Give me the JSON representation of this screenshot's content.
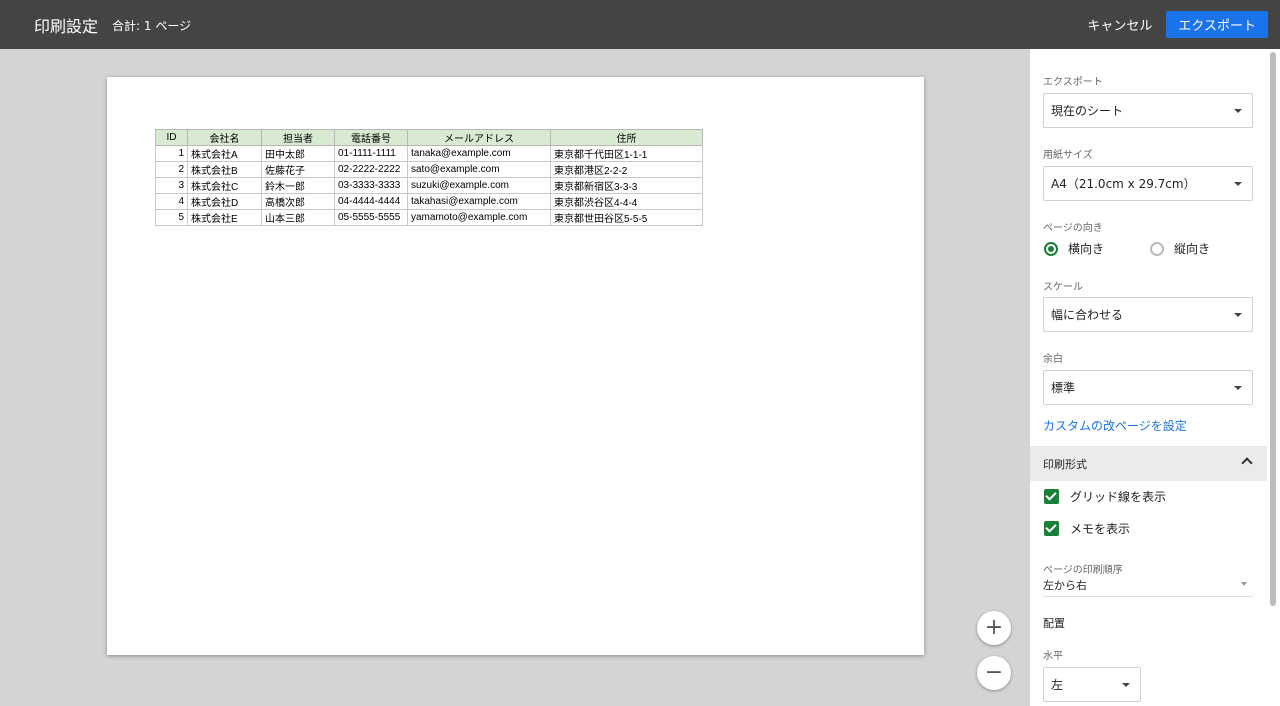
{
  "header": {
    "title": "印刷設定",
    "subtitle": "合計: 1 ページ",
    "cancel_label": "キャンセル",
    "export_label": "エクスポート"
  },
  "sheet": {
    "columns": [
      "ID",
      "会社名",
      "担当者",
      "電話番号",
      "メールアドレス",
      "住所"
    ],
    "rows": [
      [
        "1",
        "株式会社A",
        "田中太郎",
        "01-1111-1111",
        "tanaka@example.com",
        "東京都千代田区1-1-1"
      ],
      [
        "2",
        "株式会社B",
        "佐藤花子",
        "02-2222-2222",
        "sato@example.com",
        "東京都港区2-2-2"
      ],
      [
        "3",
        "株式会社C",
        "鈴木一郎",
        "03-3333-3333",
        "suzuki@example.com",
        "東京都新宿区3-3-3"
      ],
      [
        "4",
        "株式会社D",
        "高橋次郎",
        "04-4444-4444",
        "takahasi@example.com",
        "東京都渋谷区4-4-4"
      ],
      [
        "5",
        "株式会社E",
        "山本三郎",
        "05-5555-5555",
        "yamamoto@example.com",
        "東京都世田谷区5-5-5"
      ]
    ]
  },
  "zoom": {
    "in_icon": "plus-icon",
    "in_symbol": "+",
    "out_icon": "minus-icon",
    "out_symbol": "−"
  },
  "panel": {
    "export_label": "エクスポート",
    "export_value": "現在のシート",
    "paper_label": "用紙サイズ",
    "paper_value": "A4（21.0cm x 29.7cm）",
    "orientation_label": "ページの向き",
    "orientation_landscape": "横向き",
    "orientation_portrait": "縦向き",
    "scale_label": "スケール",
    "scale_value": "幅に合わせる",
    "margin_label": "余白",
    "margin_value": "標準",
    "custom_break_link": "カスタムの改ページを設定",
    "format_section": "印刷形式",
    "show_gridlines": "グリッド線を表示",
    "show_notes": "メモを表示",
    "page_order_label": "ページの印刷順序",
    "page_order_value": "左から右",
    "alignment_heading": "配置",
    "horizontal_label": "水平",
    "horizontal_value": "左"
  },
  "colors": {
    "header_bg": "#444444",
    "accent_blue": "#1a73e8",
    "accent_green": "#188038",
    "sheet_header_bg": "#d9ead3"
  }
}
